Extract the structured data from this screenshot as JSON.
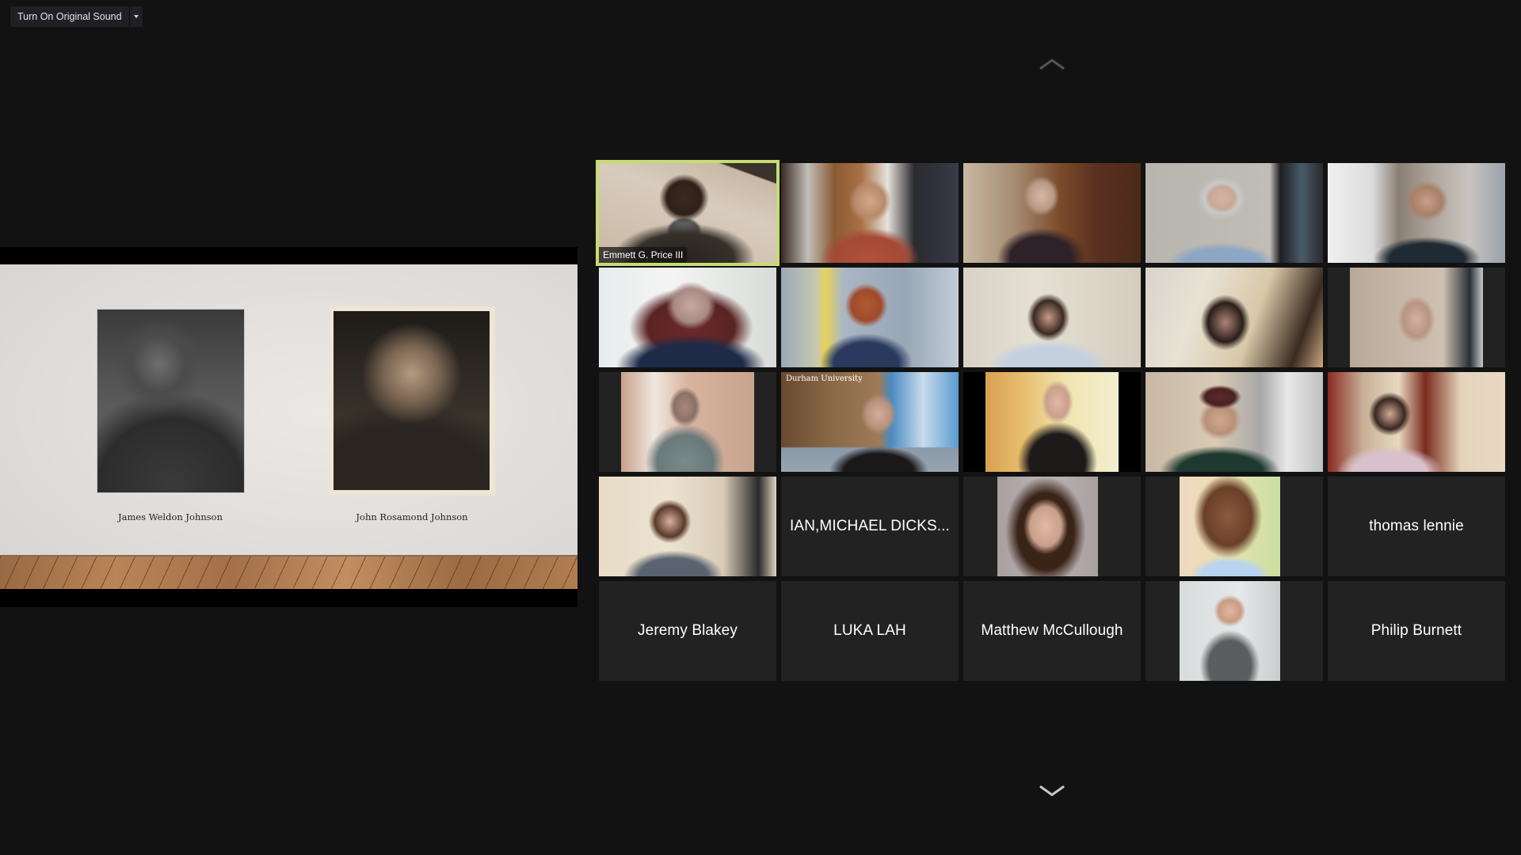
{
  "toolbar": {
    "original_sound_label": "Turn On Original Sound",
    "original_sound_dropdown_icon": "caret-down-icon"
  },
  "shared_screen": {
    "slide": {
      "portraits": [
        {
          "caption": "James Weldon Johnson",
          "tone": "black-and-white"
        },
        {
          "caption": "John Rosamond Johnson",
          "tone": "sepia"
        }
      ]
    }
  },
  "gallery": {
    "page_up_icon": "chevron-up-icon",
    "page_down_icon": "chevron-down-icon",
    "active_speaker": "Emmett G. Price III",
    "accent_color": "#c6dc72",
    "participants": [
      {
        "name": "Emmett G. Price III",
        "type": "video",
        "show_label": true
      },
      {
        "name": "",
        "type": "video"
      },
      {
        "name": "",
        "type": "video"
      },
      {
        "name": "",
        "type": "video"
      },
      {
        "name": "",
        "type": "video"
      },
      {
        "name": "",
        "type": "video"
      },
      {
        "name": "",
        "type": "video"
      },
      {
        "name": "",
        "type": "video"
      },
      {
        "name": "",
        "type": "video"
      },
      {
        "name": "",
        "type": "video"
      },
      {
        "name": "",
        "type": "video"
      },
      {
        "name": "",
        "type": "video",
        "background_text": "Durham University"
      },
      {
        "name": "",
        "type": "video"
      },
      {
        "name": "",
        "type": "video"
      },
      {
        "name": "",
        "type": "video"
      },
      {
        "name": "",
        "type": "video"
      },
      {
        "name": "IAN,MICHAEL DICKS...",
        "type": "name-only"
      },
      {
        "name": "",
        "type": "profile-photo"
      },
      {
        "name": "",
        "type": "profile-photo"
      },
      {
        "name": "thomas lennie",
        "type": "name-only"
      },
      {
        "name": "Jeremy Blakey",
        "type": "name-only"
      },
      {
        "name": "LUKA LAH",
        "type": "name-only"
      },
      {
        "name": "Matthew McCullough",
        "type": "name-only"
      },
      {
        "name": "",
        "type": "profile-photo"
      },
      {
        "name": "Philip Burnett",
        "type": "name-only"
      }
    ]
  }
}
